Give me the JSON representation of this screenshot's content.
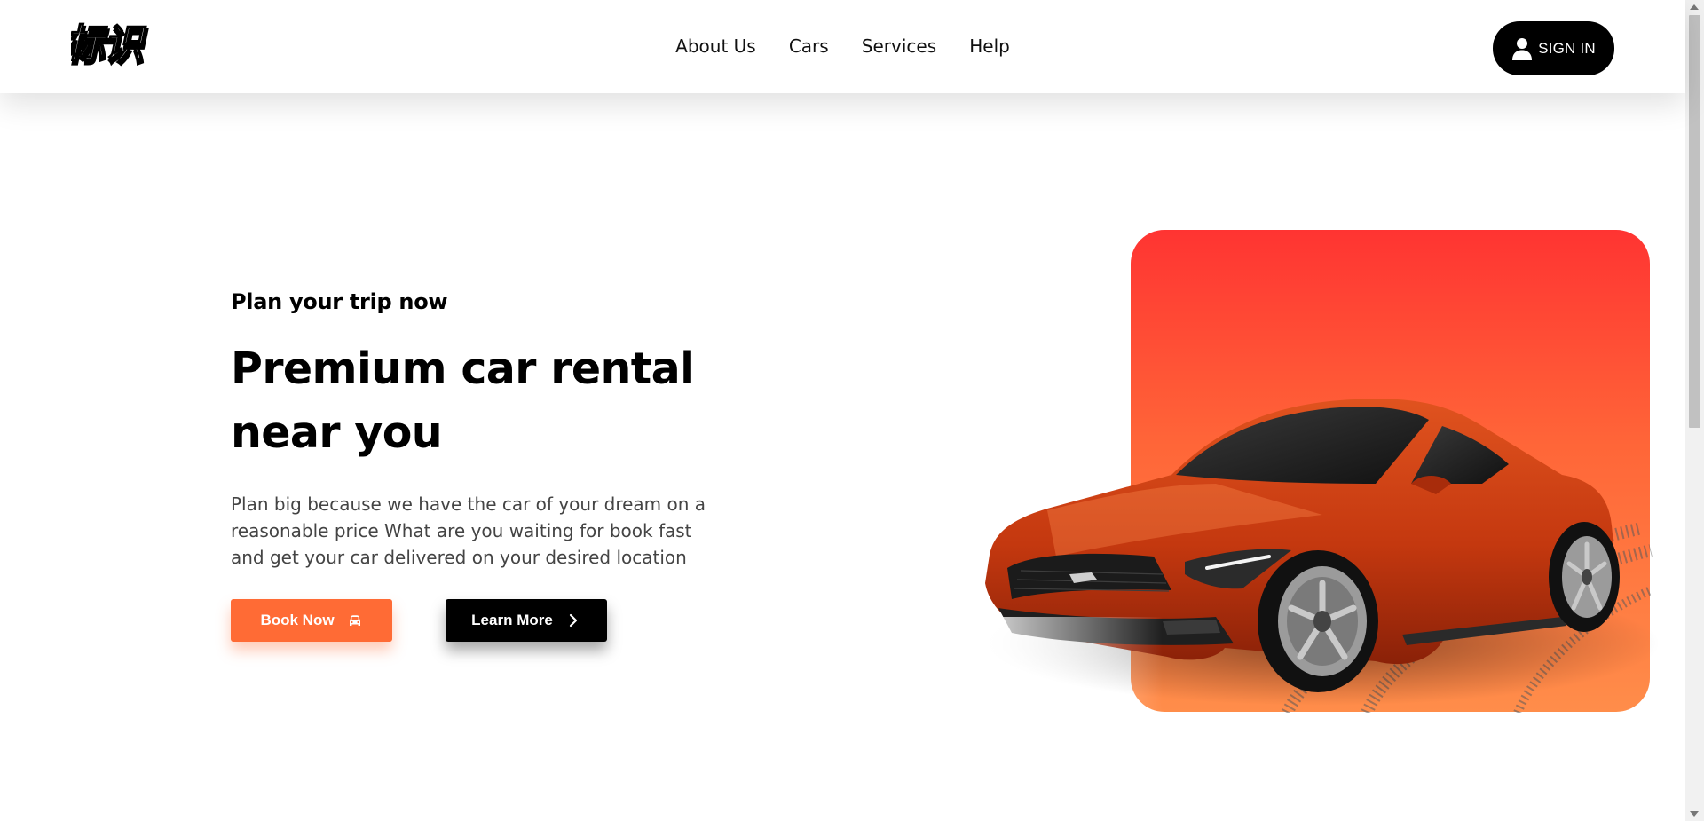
{
  "brand": {
    "logo_text": "标识",
    "logo_icon": "brand-logo"
  },
  "nav": {
    "items": [
      {
        "label": "About Us"
      },
      {
        "label": "Cars"
      },
      {
        "label": "Services"
      },
      {
        "label": "Help"
      }
    ]
  },
  "header": {
    "signin_label": "SIGN IN",
    "signin_icon": "user-icon"
  },
  "hero": {
    "subtitle": "Plan your trip now",
    "title": "Premium car rental near you",
    "description": "Plan big because we have the car of your dream on a reasonable price What are you waiting for book fast and get your car delivered on your desired location",
    "primary_cta": {
      "label": "Book Now",
      "icon": "car-icon"
    },
    "secondary_cta": {
      "label": "Learn More",
      "icon": "chevron-right-icon"
    }
  },
  "colors": {
    "accent": "#ff6b35",
    "dark": "#000000",
    "gradient_top": "#ff3432",
    "gradient_bottom": "#ff8d4a"
  }
}
